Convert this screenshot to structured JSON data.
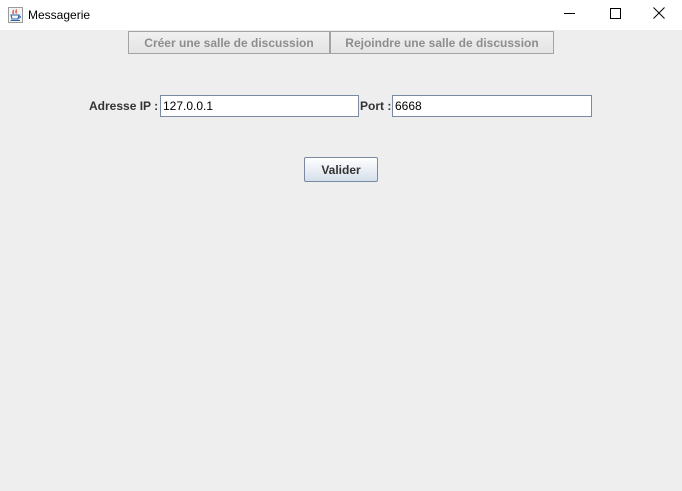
{
  "window": {
    "title": "Messagerie",
    "icon": "java-cup-icon"
  },
  "tabs": {
    "create_label": "Créer une salle de discussion",
    "join_label": "Rejoindre une salle de discussion"
  },
  "form": {
    "ip_label": "Adresse IP :",
    "ip_value": "127.0.0.1",
    "port_label": "Port :",
    "port_value": "6668",
    "submit_label": "Valider"
  },
  "colors": {
    "background": "#eeeeee",
    "disabled_text": "#8d8d8d",
    "label_text": "#333333",
    "field_border": "#7a8aa0"
  }
}
